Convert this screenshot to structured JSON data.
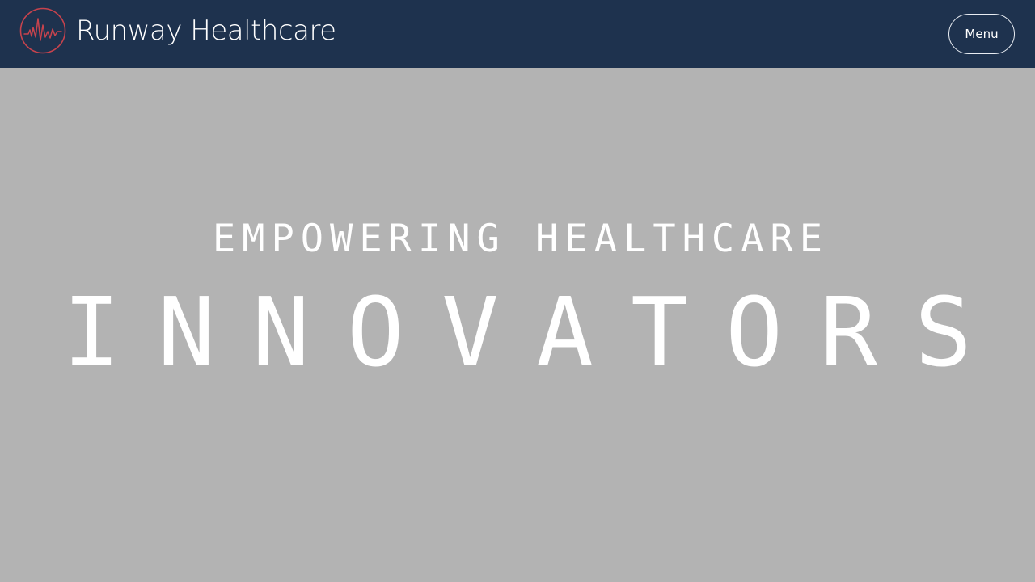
{
  "header": {
    "brand_name": "Runway Healthcare",
    "logo_icon": "heartbeat-circle-icon",
    "menu_label": "Menu"
  },
  "hero": {
    "kicker": "EMPOWERING HEALTHCARE",
    "title": "INNOVATORS"
  },
  "colors": {
    "header_background": "#1e324e",
    "page_background": "#b3b3b3",
    "logo_accent": "#c7434d",
    "text": "#ffffff"
  }
}
